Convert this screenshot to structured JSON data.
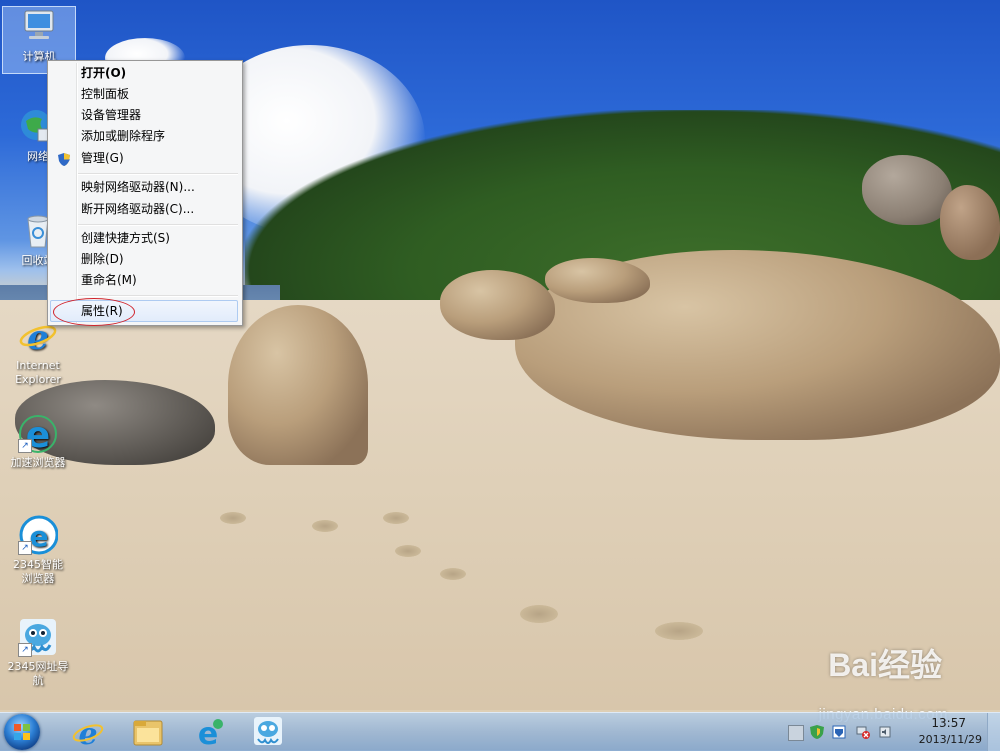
{
  "desktop": {
    "icons": [
      {
        "label": "计算机"
      },
      {
        "label": "网络"
      },
      {
        "label": "回收站"
      },
      {
        "label": "Internet Explorer"
      },
      {
        "label": "加速浏览器"
      },
      {
        "label": "2345智能浏览器"
      },
      {
        "label": "2345网址导航"
      }
    ]
  },
  "context_menu": {
    "items": [
      {
        "label": "打开(O)"
      },
      {
        "label": "控制面板"
      },
      {
        "label": "设备管理器"
      },
      {
        "label": "添加或删除程序"
      },
      {
        "label": "管理(G)"
      },
      {
        "label": "映射网络驱动器(N)..."
      },
      {
        "label": "断开网络驱动器(C)..."
      },
      {
        "label": "创建快捷方式(S)"
      },
      {
        "label": "删除(D)"
      },
      {
        "label": "重命名(M)"
      },
      {
        "label": "属性(R)"
      }
    ]
  },
  "taskbar": {
    "clock_time": "13:57",
    "clock_date": "2013/11/29"
  },
  "watermark": {
    "brand": "Bai经验",
    "url": "jingyan.baidu.com"
  },
  "colors": {
    "annotation_circle": "#d0222a",
    "menu_hover": "#e2ecfb"
  }
}
